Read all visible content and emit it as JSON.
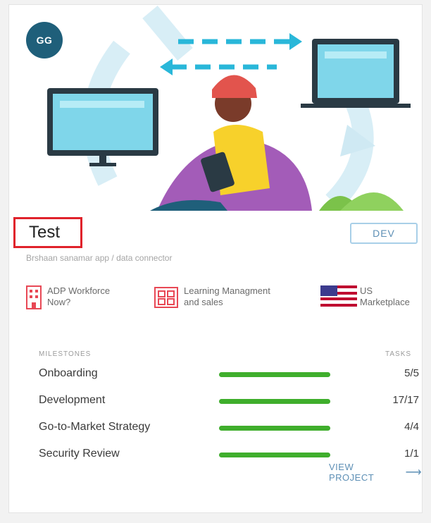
{
  "card": {
    "avatar_initials": "GG",
    "title": "Test",
    "environment": "DEV",
    "description": "Brshaan sanamar app / data connector",
    "features": [
      {
        "icon": "building-icon",
        "line1": "ADP Workforce",
        "line2": "Now?",
        "color": "#e84855"
      },
      {
        "icon": "grid-app-icon",
        "line1": "Learning Managment",
        "line2": "and sales",
        "color": "#e84855"
      },
      {
        "icon": "us-flag-icon",
        "line1": "US",
        "line2": "Marketplace",
        "color": "#bf0a30"
      }
    ],
    "milestones_header": "MILESTONES",
    "tasks_header": "TASKS",
    "milestones": [
      {
        "name": "Onboarding",
        "count": "5/5",
        "progress": 1.0
      },
      {
        "name": "Development",
        "count": "17/17",
        "progress": 1.0
      },
      {
        "name": "Go-to-Market Strategy",
        "count": "4/4",
        "progress": 1.0
      },
      {
        "name": "Security Review",
        "count": "1/1",
        "progress": 1.0
      }
    ],
    "view_project": "VIEW PROJECT",
    "progress_color": "#3fae2c",
    "highlight_color": "#e0222b"
  }
}
